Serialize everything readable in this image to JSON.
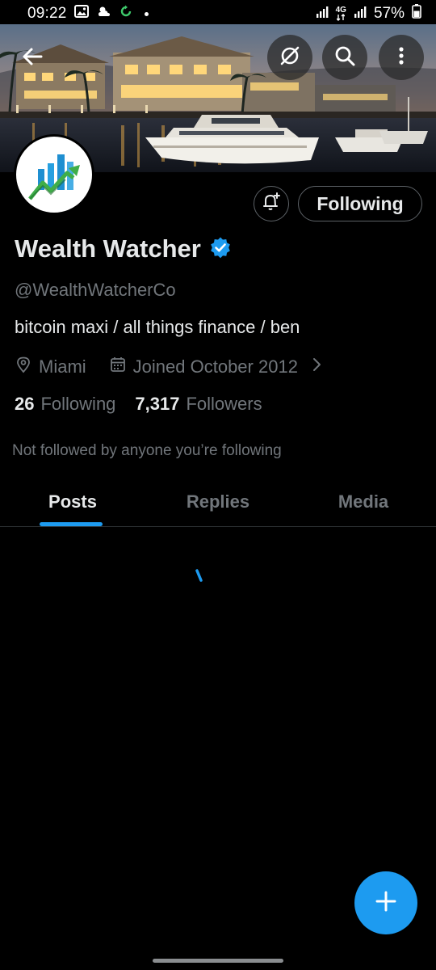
{
  "status_bar": {
    "time": "09:22",
    "network": "4G",
    "battery": "57%"
  },
  "profile": {
    "display_name": "Wealth Watcher",
    "verified": true,
    "handle": "@WealthWatcherCo",
    "bio": "bitcoin maxi / all things finance / ben",
    "location": "Miami",
    "joined": "Joined October 2012",
    "following_count": "26",
    "following_label": "Following",
    "followers_count": "7,317",
    "followers_label": "Followers",
    "not_followed_note": "Not followed by anyone you’re following"
  },
  "actions": {
    "follow_state_label": "Following"
  },
  "tabs": [
    {
      "label": "Posts",
      "active": true
    },
    {
      "label": "Replies",
      "active": false
    },
    {
      "label": "Media",
      "active": false
    }
  ],
  "colors": {
    "accent": "#1d9bf0",
    "background": "#000000",
    "text_primary": "#e7e9ea",
    "text_secondary": "#71767b",
    "border": "#2f3336"
  },
  "icons": {
    "back": "arrow-left-icon",
    "grok": "grok-icon",
    "search": "search-icon",
    "more": "more-vertical-icon",
    "notifications": "bell-plus-icon",
    "verified": "verified-badge-icon",
    "location": "location-pin-icon",
    "calendar": "calendar-icon",
    "chevron": "chevron-right-icon",
    "compose": "plus-icon"
  }
}
